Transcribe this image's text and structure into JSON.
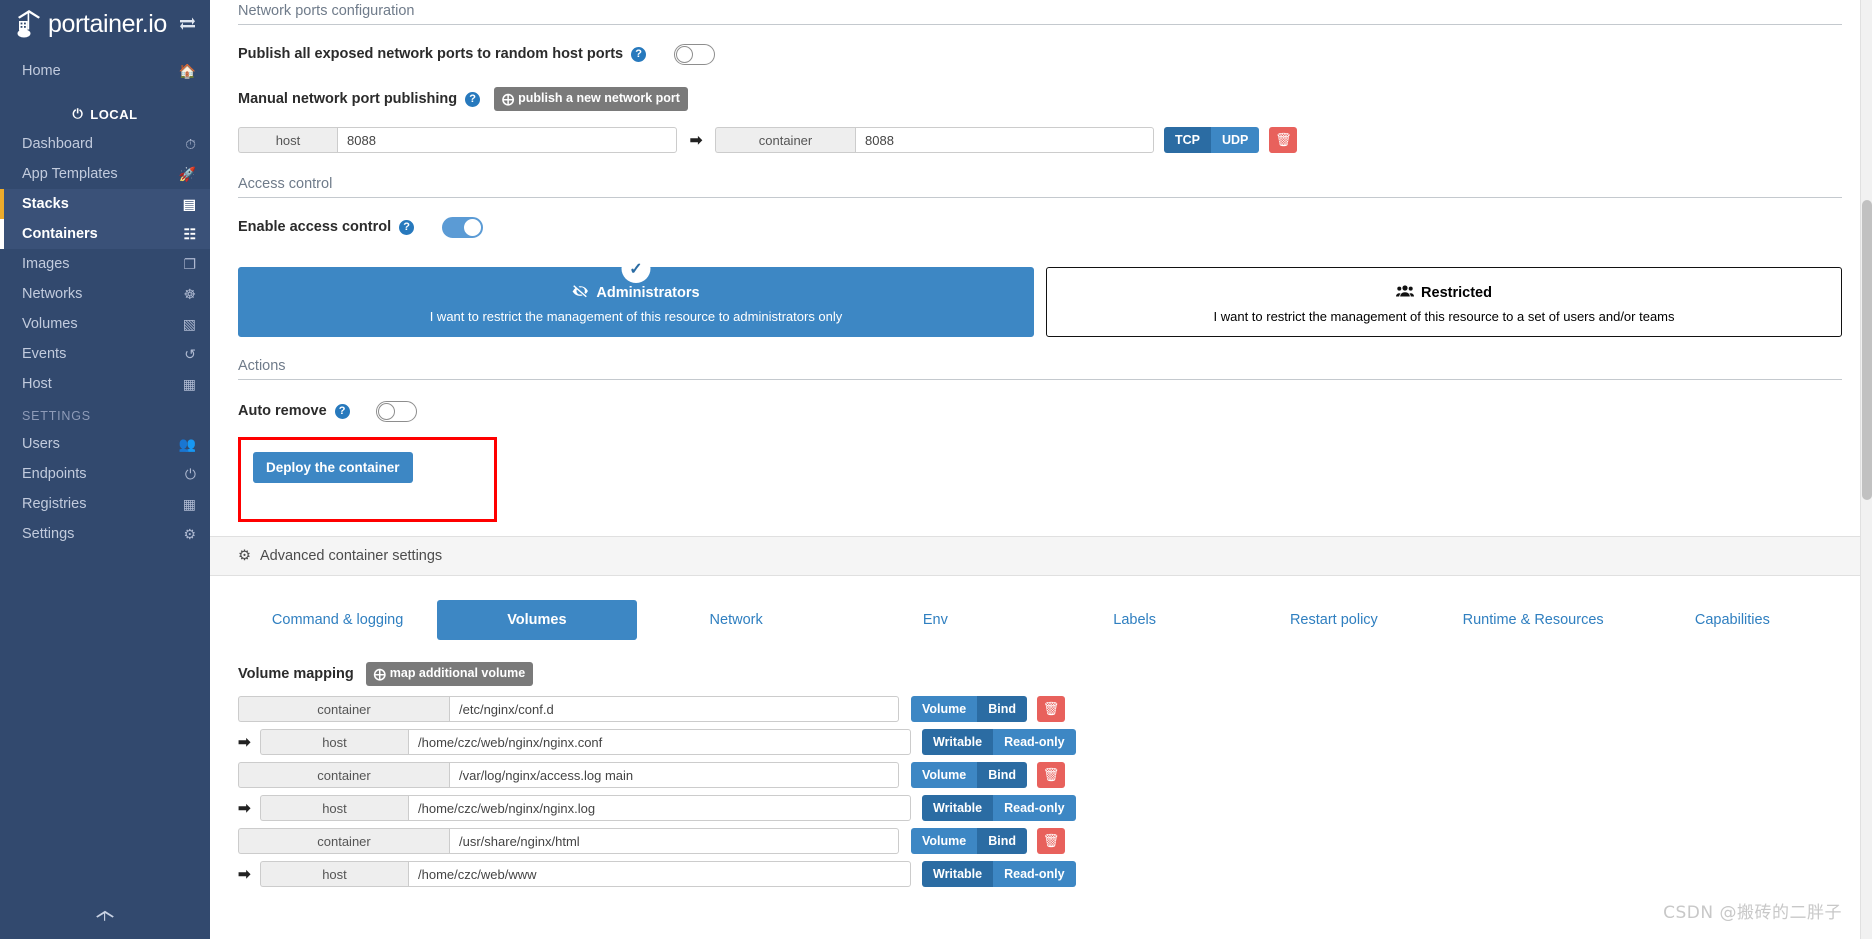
{
  "brand": {
    "name": "portainer.io",
    "toggle_icon": "exchange-icon"
  },
  "sidebar": {
    "home": {
      "label": "Home",
      "icon": "home-icon"
    },
    "endpoint_badge": {
      "label": "LOCAL",
      "icon": "plug-icon"
    },
    "items": [
      {
        "label": "Dashboard",
        "icon": "dashboard-icon",
        "active": false
      },
      {
        "label": "App Templates",
        "icon": "rocket-icon",
        "active": false
      },
      {
        "label": "Stacks",
        "icon": "stacks-icon",
        "active": true
      },
      {
        "label": "Containers",
        "icon": "containers-icon",
        "active": true
      },
      {
        "label": "Images",
        "icon": "images-icon",
        "active": false
      },
      {
        "label": "Networks",
        "icon": "networks-icon",
        "active": false
      },
      {
        "label": "Volumes",
        "icon": "volumes-icon",
        "active": false
      },
      {
        "label": "Events",
        "icon": "events-icon",
        "active": false
      },
      {
        "label": "Host",
        "icon": "host-icon",
        "active": false
      }
    ],
    "settings_label": "SETTINGS",
    "settings_items": [
      {
        "label": "Users",
        "icon": "users-icon"
      },
      {
        "label": "Endpoints",
        "icon": "plug-icon"
      },
      {
        "label": "Registries",
        "icon": "database-icon"
      },
      {
        "label": "Settings",
        "icon": "gears-icon"
      }
    ],
    "footer_icon": "portainer-mark-icon"
  },
  "network_ports": {
    "section_title": "Network ports configuration",
    "publish_all_label": "Publish all exposed network ports to random host ports",
    "publish_all_on": false,
    "manual_label": "Manual network port publishing",
    "add_port_button": "publish a new network port",
    "port_row": {
      "host_addon": "host",
      "host_value": "8088",
      "arrow": "➡",
      "container_addon": "container",
      "container_value": "8088",
      "protocol_tcp": "TCP",
      "protocol_udp": "UDP",
      "protocol_selected": "TCP",
      "delete_icon": "trash-icon"
    }
  },
  "access_control": {
    "section_title": "Access control",
    "enable_label": "Enable access control",
    "enable_on": true,
    "cards": [
      {
        "title": "Administrators",
        "icon": "eye-slash-icon",
        "desc": "I want to restrict the management of this resource to administrators only",
        "selected": true,
        "check_icon": "check-icon"
      },
      {
        "title": "Restricted",
        "icon": "users-icon",
        "desc": "I want to restrict the management of this resource to a set of users and/or teams",
        "selected": false,
        "check_icon": ""
      }
    ]
  },
  "actions": {
    "section_title": "Actions",
    "auto_remove_label": "Auto remove",
    "auto_remove_on": false,
    "deploy_button": "Deploy the container",
    "highlight_color": "#ff0000"
  },
  "advanced": {
    "bar_label": "Advanced container settings",
    "bar_icon": "gear-icon",
    "tabs": [
      {
        "label": "Command & logging",
        "active": false
      },
      {
        "label": "Volumes",
        "active": true
      },
      {
        "label": "Network",
        "active": false
      },
      {
        "label": "Env",
        "active": false
      },
      {
        "label": "Labels",
        "active": false
      },
      {
        "label": "Restart policy",
        "active": false
      },
      {
        "label": "Runtime & Resources",
        "active": false
      },
      {
        "label": "Capabilities",
        "active": false
      }
    ]
  },
  "volumes": {
    "mapping_label": "Volume mapping",
    "add_button": "map additional volume",
    "type_volume": "Volume",
    "type_bind": "Bind",
    "perm_writable": "Writable",
    "perm_readonly": "Read-only",
    "delete_icon": "trash-icon",
    "container_addon": "container",
    "host_addon": "host",
    "arrow": "➡",
    "rows": [
      {
        "container_path": "/etc/nginx/conf.d",
        "host_path": "/home/czc/web/nginx/nginx.conf",
        "type_selected": "Bind",
        "perm_selected": "Writable"
      },
      {
        "container_path": "/var/log/nginx/access.log  main",
        "host_path": "/home/czc/web/nginx/nginx.log",
        "type_selected": "Bind",
        "perm_selected": "Writable"
      },
      {
        "container_path": "/usr/share/nginx/html",
        "host_path": "/home/czc/web/www",
        "type_selected": "Bind",
        "perm_selected": "Writable"
      }
    ]
  },
  "watermark": {
    "text": "CSDN @搬砖的二胖子"
  },
  "colors": {
    "sidebar_bg": "#32496e",
    "accent_blue": "#3d87c4",
    "accent_blue_dark": "#2b6ca3",
    "danger_red": "#e8615c",
    "highlight_red": "#ff0000"
  }
}
